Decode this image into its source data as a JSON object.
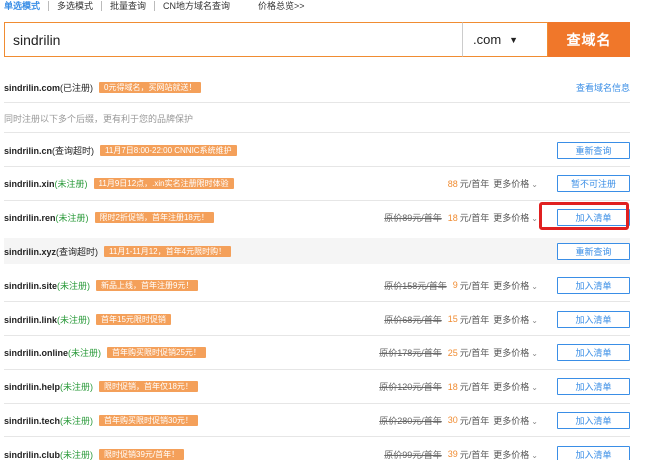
{
  "tabs": [
    "单选模式",
    "多选模式",
    "批量查询",
    "CN地方域名查询",
    "价格总览>>"
  ],
  "search": {
    "value": "sindrilin",
    "tld": ".com",
    "button": "查域名"
  },
  "top": {
    "domain": "sindrilin.com",
    "status": "(已注册)",
    "promo": "0元得域名，买网站就送！",
    "link": "查看域名信息"
  },
  "note": "同时注册以下多个后缀，更有利于您的品牌保护",
  "rows": [
    {
      "domain": "sindrilin.cn",
      "status": "(查询超时)",
      "green": false,
      "promo": "11月7日8:00-22:00 CNNIC系统维护",
      "orig": "",
      "price": "",
      "unit": "",
      "more": "",
      "button": "重新查询"
    },
    {
      "domain": "sindrilin.xin",
      "status": "(未注册)",
      "green": true,
      "promo": "11月9日12点，.xin实名注册限时体验",
      "orig": "",
      "price": "88",
      "unit": "元/首年",
      "more": "更多价格",
      "button": "暂不可注册"
    },
    {
      "domain": "sindrilin.ren",
      "status": "(未注册)",
      "green": true,
      "promo": "限时2折促销，首年注册18元！",
      "orig": "原价89元/首年",
      "price": "18",
      "unit": "元/首年",
      "more": "更多价格",
      "button": "加入清单"
    },
    {
      "domain": "sindrilin.xyz",
      "status": "(查询超时)",
      "green": false,
      "promo": "11月1-11月12，首年4元限时购！",
      "orig": "",
      "price": "",
      "unit": "",
      "more": "",
      "button": "重新查询"
    },
    {
      "domain": "sindrilin.site",
      "status": "(未注册)",
      "green": true,
      "promo": "新品上线，首年注册9元！",
      "orig": "原价158元/首年",
      "price": "9",
      "unit": "元/首年",
      "more": "更多价格",
      "button": "加入清单"
    },
    {
      "domain": "sindrilin.link",
      "status": "(未注册)",
      "green": true,
      "promo": "首年15元限时促销",
      "orig": "原价68元/首年",
      "price": "15",
      "unit": "元/首年",
      "more": "更多价格",
      "button": "加入清单"
    },
    {
      "domain": "sindrilin.online",
      "status": "(未注册)",
      "green": true,
      "promo": "首年购买限时促销25元！",
      "orig": "原价178元/首年",
      "price": "25",
      "unit": "元/首年",
      "more": "更多价格",
      "button": "加入清单"
    },
    {
      "domain": "sindrilin.help",
      "status": "(未注册)",
      "green": true,
      "promo": "限时促销，首年仅18元！",
      "orig": "原价120元/首年",
      "price": "18",
      "unit": "元/首年",
      "more": "更多价格",
      "button": "加入清单"
    },
    {
      "domain": "sindrilin.tech",
      "status": "(未注册)",
      "green": true,
      "promo": "首年购买限时促销30元！",
      "orig": "原价280元/首年",
      "price": "30",
      "unit": "元/首年",
      "more": "更多价格",
      "button": "加入清单"
    },
    {
      "domain": "sindrilin.club",
      "status": "(未注册)",
      "green": true,
      "promo": "限时促销39元/首年！",
      "orig": "原价99元/首年",
      "price": "39",
      "unit": "元/首年",
      "more": "更多价格",
      "button": "加入清单"
    }
  ],
  "colors": {
    "accent": "#f0772a",
    "link": "#3a8ee6",
    "available": "#2a9a3a",
    "promo": "#f4a05a",
    "highlight": "#e02020"
  }
}
